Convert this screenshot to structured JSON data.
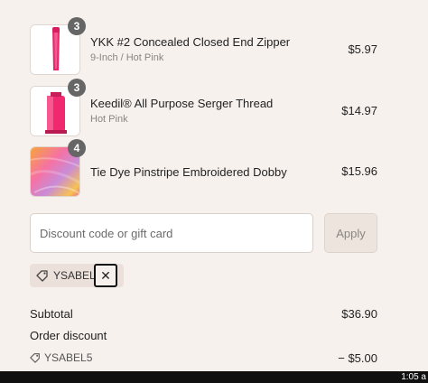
{
  "items": [
    {
      "quantity": "3",
      "name": "YKK #2 Concealed Closed End Zipper",
      "variant": "9-Inch / Hot Pink",
      "price": "$5.97",
      "image": "pink-zipper"
    },
    {
      "quantity": "3",
      "name": "Keedil® All Purpose Serger Thread",
      "variant": "Hot Pink",
      "price": "$14.97",
      "image": "pink-thread-spool"
    },
    {
      "quantity": "4",
      "name": "Tie Dye Pinstripe Embroidered Dobby",
      "variant": "",
      "price": "$15.96",
      "image": "tie-dye-fabric"
    }
  ],
  "discount": {
    "placeholder": "Discount code or gift card",
    "apply_label": "Apply",
    "applied_code": "YSABEL5",
    "remove_icon": "close-icon",
    "tag_icon": "tag-icon"
  },
  "summary": {
    "subtotal_label": "Subtotal",
    "subtotal_value": "$36.90",
    "order_discount_label": "Order discount",
    "discount_code": "YSABEL5",
    "discount_value": "− $5.00"
  },
  "taskbar": {
    "clock": "1:05 a"
  }
}
